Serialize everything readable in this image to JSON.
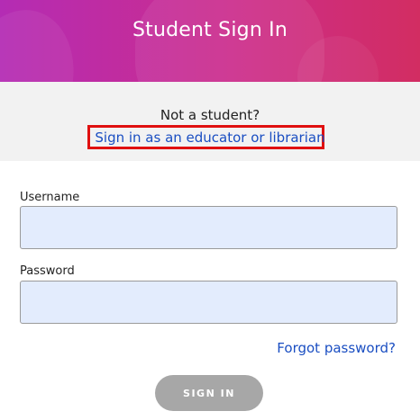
{
  "header": {
    "title": "Student Sign In"
  },
  "alternate": {
    "question": "Not a student?",
    "link_label": "Sign in as an educator or librarian"
  },
  "form": {
    "username_label": "Username",
    "username_value": "",
    "password_label": "Password",
    "password_value": "",
    "forgot_label": "Forgot password?",
    "submit_label": "SIGN IN"
  },
  "colors": {
    "header_gradient_start": "#b42cb4",
    "header_gradient_end": "#d22d62",
    "link": "#1a4ec2",
    "highlight_box": "#e01010",
    "input_fill": "#e3ecfd",
    "button_disabled": "#a7a7a7"
  }
}
